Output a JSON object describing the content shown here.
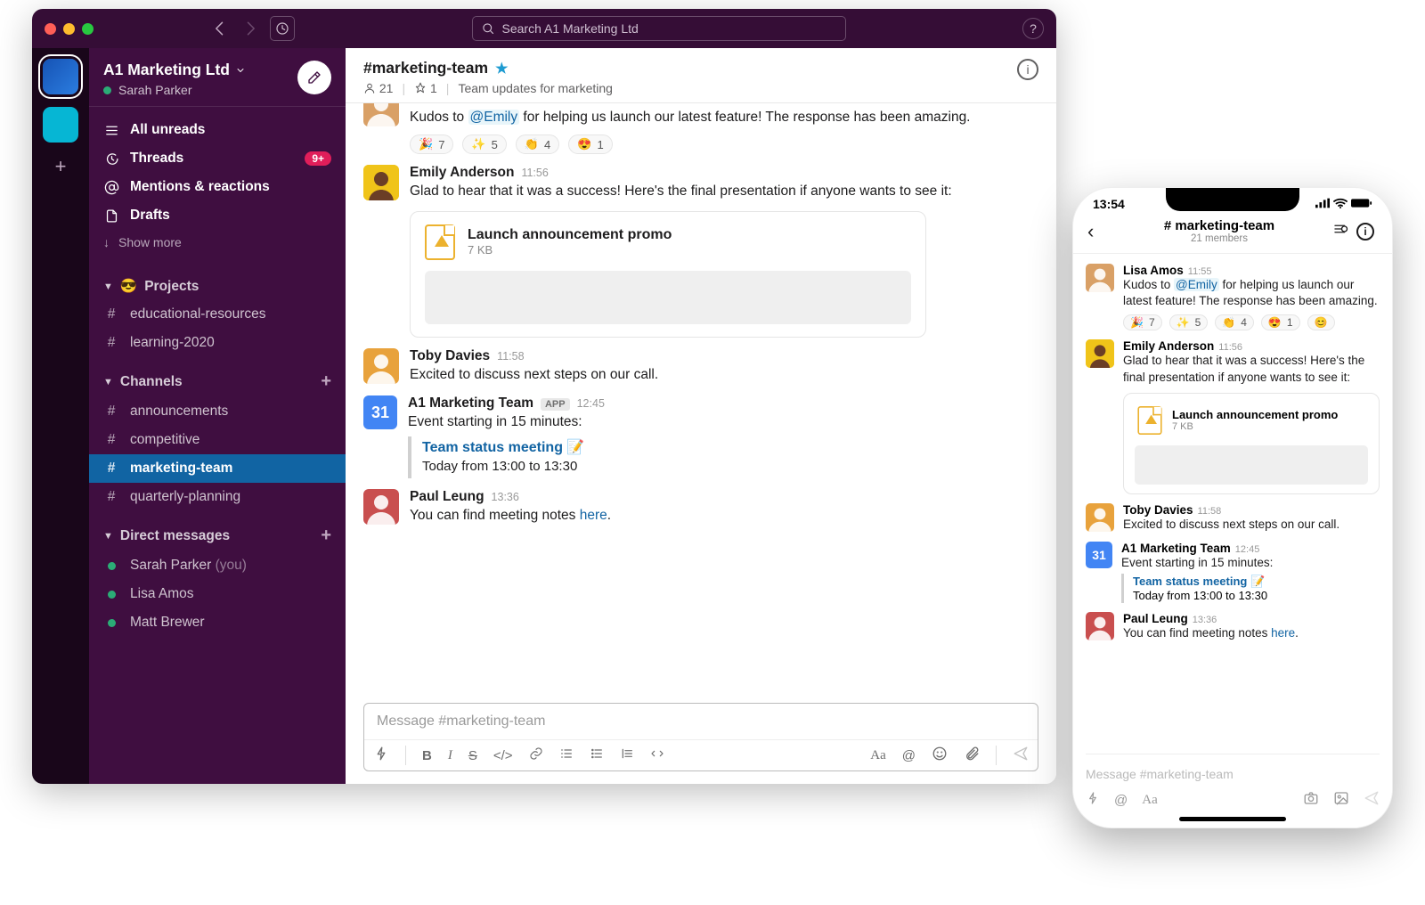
{
  "titlebar": {
    "search_placeholder": "Search A1 Marketing Ltd"
  },
  "workspace": {
    "name": "A1 Marketing Ltd",
    "user": "Sarah Parker"
  },
  "sidebar_items": [
    {
      "icon": "unreads",
      "label": "All unreads",
      "strong": true
    },
    {
      "icon": "threads",
      "label": "Threads",
      "strong": true,
      "badge": "9+"
    },
    {
      "icon": "mentions",
      "label": "Mentions & reactions",
      "strong": true
    },
    {
      "icon": "drafts",
      "label": "Drafts",
      "strong": true
    }
  ],
  "showmore": "Show more",
  "sections": {
    "projects": {
      "title": "Projects",
      "emoji": "😎",
      "channels": [
        "educational-resources",
        "learning-2020"
      ]
    },
    "channels": {
      "title": "Channels",
      "items": [
        "announcements",
        "competitive",
        "marketing-team",
        "quarterly-planning"
      ],
      "selected": "marketing-team"
    },
    "dms": {
      "title": "Direct messages",
      "items": [
        {
          "name": "Sarah Parker",
          "suffix": "(you)"
        },
        {
          "name": "Lisa Amos",
          "suffix": ""
        },
        {
          "name": "Matt Brewer",
          "suffix": ""
        }
      ]
    }
  },
  "channel": {
    "name": "#marketing-team",
    "members": "21",
    "pins": "1",
    "topic": "Team updates for marketing"
  },
  "messages": [
    {
      "author": "Lisa Amos",
      "time": "11:55",
      "avatar": "lisa",
      "body_pre": "Kudos to ",
      "mention": "@Emily",
      "body_post": " for helping us launch our latest feature! The response has been amazing.",
      "reactions": [
        {
          "e": "🎉",
          "c": "7"
        },
        {
          "e": "✨",
          "c": "5"
        },
        {
          "e": "👏",
          "c": "4"
        },
        {
          "e": "😍",
          "c": "1"
        }
      ]
    },
    {
      "author": "Emily Anderson",
      "time": "11:56",
      "avatar": "emily",
      "body": "Glad to hear that it was a success! Here's the final presentation if anyone wants to see it:",
      "attachment": {
        "title": "Launch announcement promo",
        "meta": "7 KB"
      }
    },
    {
      "author": "Toby Davies",
      "time": "11:58",
      "avatar": "toby",
      "body": "Excited to discuss next steps on our call."
    },
    {
      "author": "A1 Marketing Team",
      "time": "12:45",
      "avatar": "cal",
      "is_app": true,
      "app_label": "APP",
      "body": "Event starting in 15 minutes:",
      "event": {
        "title": "Team status meeting",
        "emoji": "📝",
        "when": "Today from 13:00 to 13:30"
      }
    },
    {
      "author": "Paul Leung",
      "time": "13:36",
      "avatar": "paul",
      "body_pre": "You can find meeting notes ",
      "link": "here",
      "body_post": "."
    }
  ],
  "composer": {
    "placeholder": "Message #marketing-team"
  },
  "phone": {
    "clock": "13:54",
    "title": "# marketing-team",
    "members": "21 members",
    "composer_placeholder": "Message #marketing-team"
  }
}
